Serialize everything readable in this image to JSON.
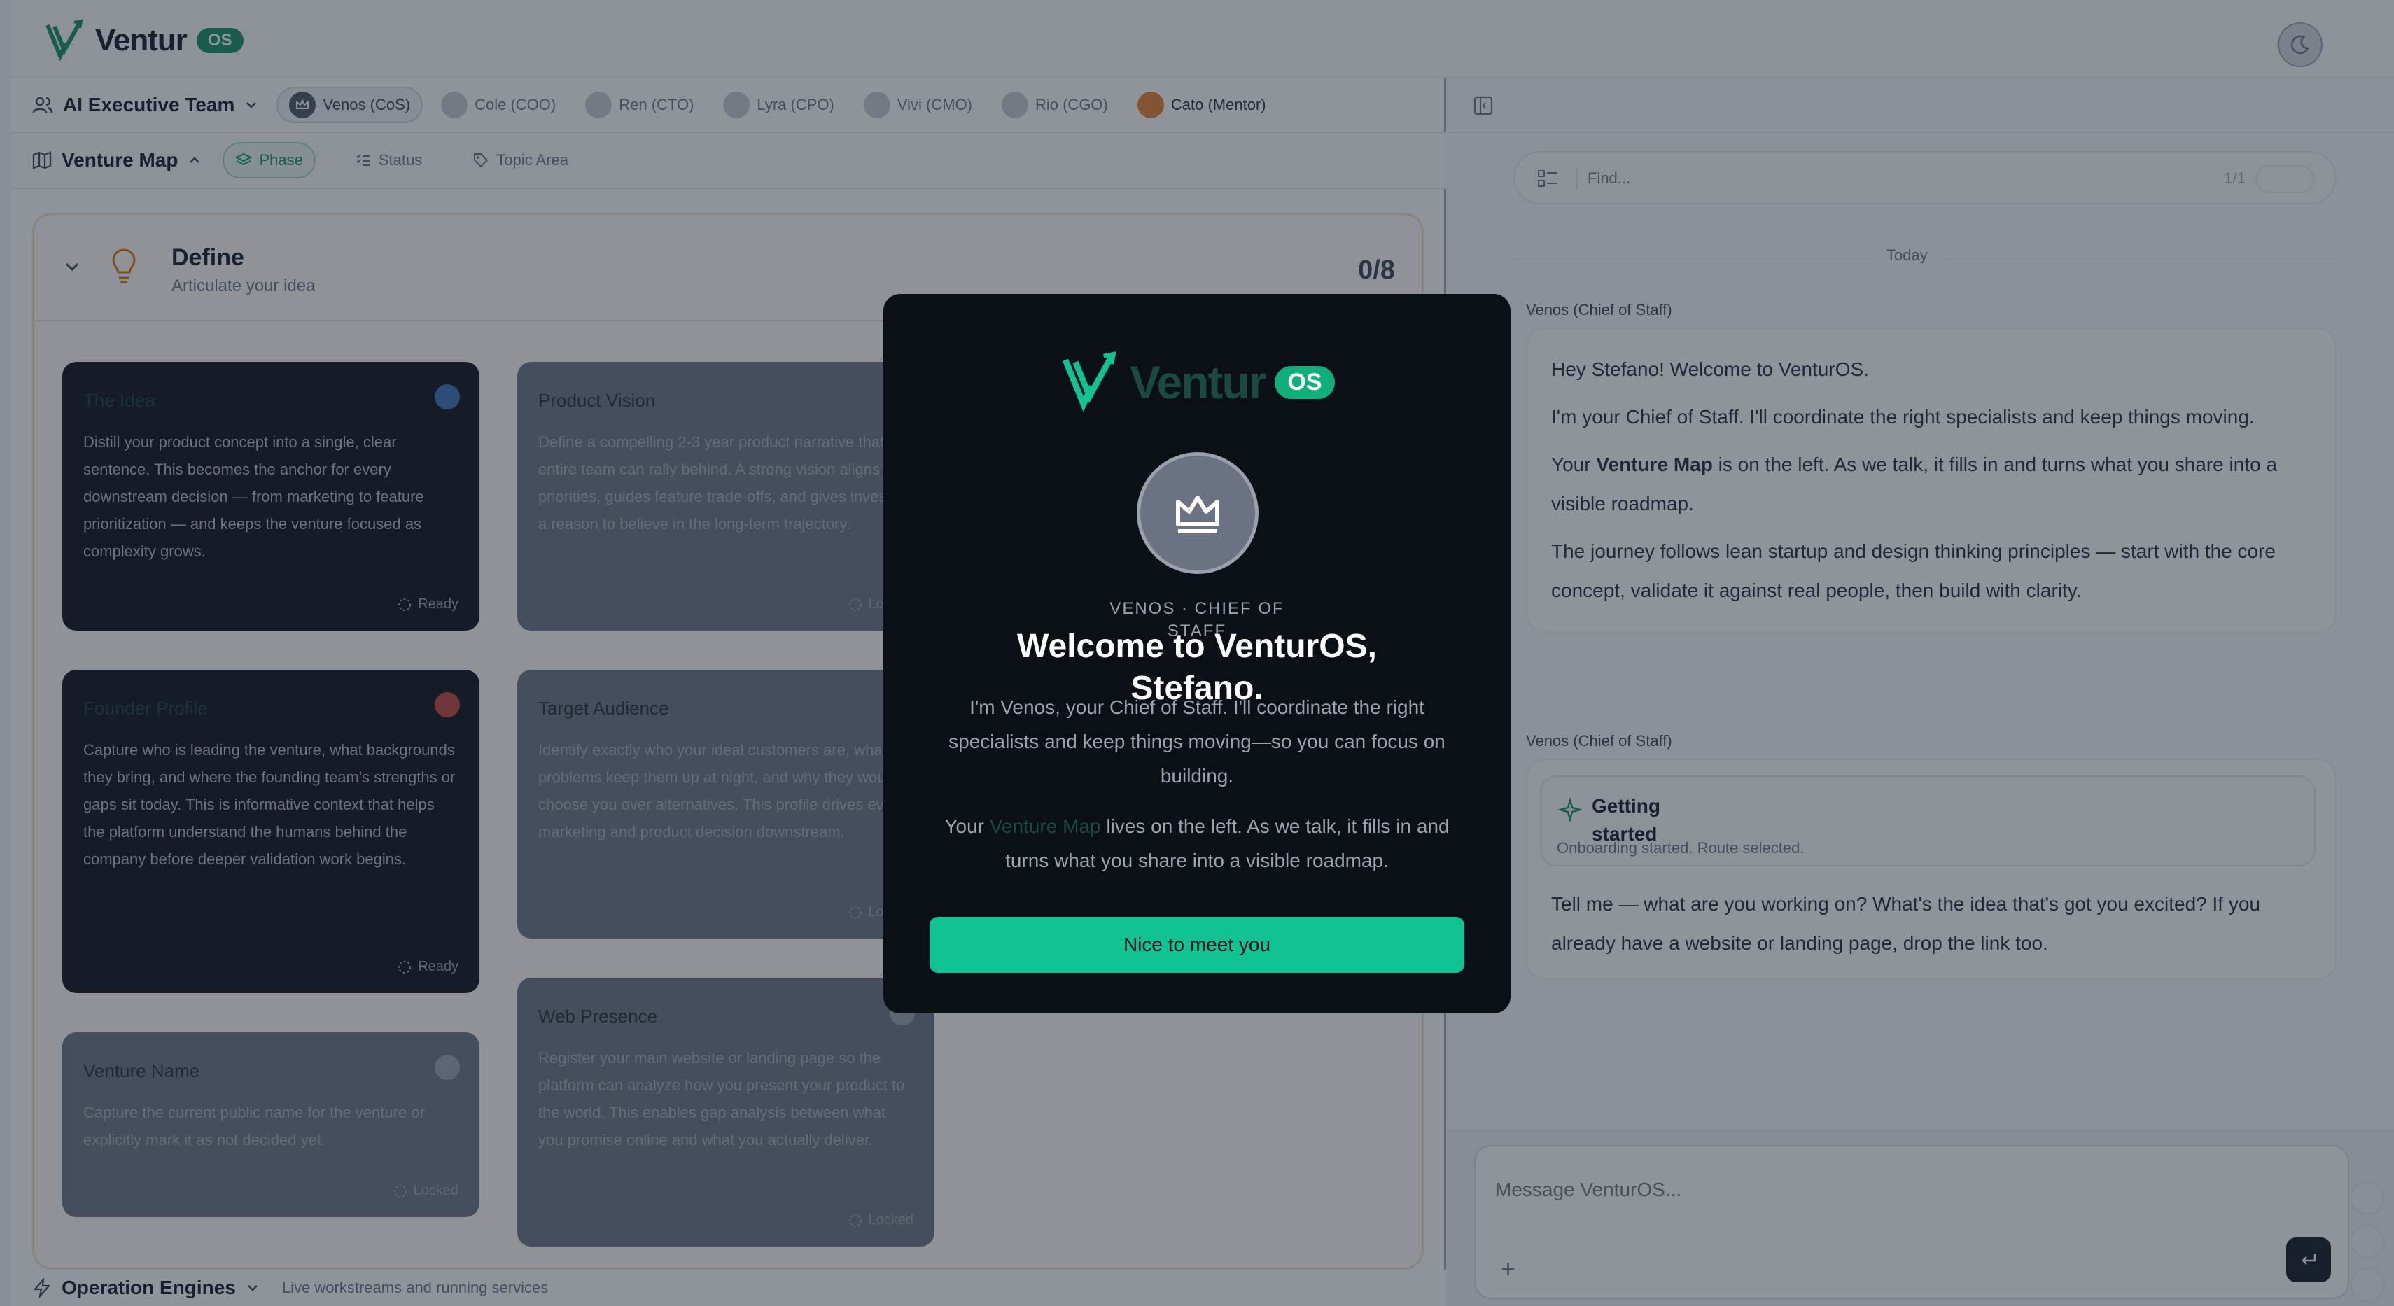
{
  "brand": {
    "name": "Ventur",
    "badge": "OS"
  },
  "team_bar": {
    "title": "AI Executive Team",
    "members": [
      {
        "label": "Venos (CoS)",
        "active": true
      },
      {
        "label": "Cole (COO)",
        "active": false
      },
      {
        "label": "Ren (CTO)",
        "active": false
      },
      {
        "label": "Lyra (CPO)",
        "active": false
      },
      {
        "label": "Vivi (CMO)",
        "active": false
      },
      {
        "label": "Rio (CGO)",
        "active": false
      },
      {
        "label": "Cato (Mentor)",
        "active": false
      }
    ]
  },
  "map_bar": {
    "title": "Venture Map",
    "filters": [
      "Phase",
      "Status",
      "Topic Area"
    ]
  },
  "phase": {
    "name": "Define",
    "subtitle": "Articulate your idea",
    "count": "0/8"
  },
  "cards": [
    {
      "title": "The Idea",
      "body": "Distill your product concept into a single, clear sentence. This becomes the anchor for every downstream decision — from marketing to feature prioritization — and keeps the venture focused as complexity grows.",
      "status": "Ready"
    },
    {
      "title": "Product Vision",
      "body": "Define a compelling 2-3 year product narrative that the entire team can rally behind. A strong vision aligns priorities, guides feature trade-offs, and gives investors a reason to believe in the long-term trajectory.",
      "status": "Locked"
    },
    {
      "title": "Founder Profile",
      "body": "Capture who is leading the venture, what backgrounds they bring, and where the founding team's strengths or gaps sit today. This is informative context that helps the platform understand the humans behind the company before deeper validation work begins.",
      "status": "Ready"
    },
    {
      "title": "Target Audience",
      "body": "Identify exactly who your ideal customers are, what problems keep them up at night, and why they would choose you over alternatives. This profile drives every marketing and product decision downstream.",
      "status": "Locked"
    },
    {
      "title": "Venture Name",
      "body": "Capture the current public name for the venture or explicitly mark it as not decided yet.",
      "status": "Locked"
    },
    {
      "title": "Web Presence",
      "body": "Register your main website or landing page so the platform can analyze how you present your product to the world. This enables gap analysis between what you promise online and what you actually deliver.",
      "status": "Locked"
    }
  ],
  "engines": {
    "title": "Operation Engines",
    "subtitle": "Live workstreams and running services"
  },
  "chat": {
    "search_placeholder": "Find...",
    "search_count": "1/1",
    "day": "Today",
    "sender": "Venos (Chief of Staff)",
    "msg1": {
      "p1": "Hey Stefano! Welcome to VenturOS.",
      "p2": "I'm your Chief of Staff. I'll coordinate the right specialists and keep things moving.",
      "p3_before": "Your ",
      "p3_bold": "Venture Map",
      "p3_after": " is on the left. As we talk, it fills in and turns what you share into a visible roadmap.",
      "p4": "The journey follows lean startup and design thinking principles — start with the core concept, validate it against real people, then build with clarity."
    },
    "msg2": {
      "tool_title": "Getting",
      "tool_title2": "started",
      "tool_sub": "Onboarding started. Route selected.",
      "text": "Tell me — what are you working on? What's the idea that's got you excited? If you already have a website or landing page, drop the link too."
    },
    "composer_placeholder": "Message VenturOS..."
  },
  "modal": {
    "brand": "Ventur",
    "badge": "OS",
    "role_line1": "VENOS · CHIEF OF",
    "role_line2": "STAFF",
    "title": "Welcome to VenturOS, Stefano.",
    "text1": "I'm Venos, your Chief of Staff. I'll coordinate the right specialists and keep things moving—so you can focus on building.",
    "text2_before": "Your ",
    "text2_link": "Venture Map",
    "text2_after": " lives on the left. As we talk, it fills in and turns what you share into a visible roadmap.",
    "button": "Nice to meet you"
  },
  "colors": {
    "accent": "#10c393",
    "brand": "#0f8f63",
    "modal_bg": "#0b0f16"
  }
}
